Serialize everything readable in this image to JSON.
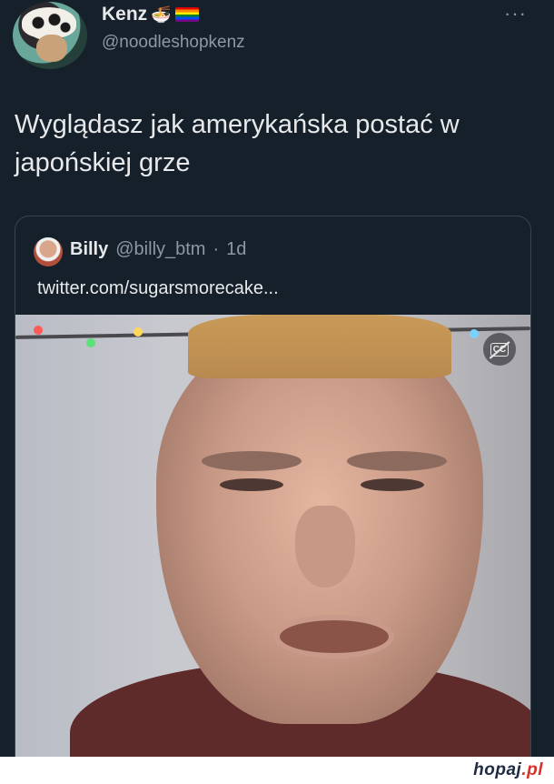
{
  "tweet": {
    "display_name": "Kenz",
    "name_emoji": "🍜",
    "handle": "@noodleshopkenz",
    "more": "···",
    "text": "Wyglądasz jak amerykańska postać w japońskiej grze"
  },
  "quote": {
    "name": "Billy",
    "handle": "@billy_btm",
    "separator": "·",
    "time": "1d",
    "link": "twitter.com/sugarsmorecake..."
  },
  "media": {
    "cc_label": "CC"
  },
  "watermark": {
    "site": "hopaj",
    "tld": ".pl"
  },
  "colors": {
    "background": "#15202b",
    "text": "#e7e9ea",
    "secondary_text": "#8b98a5",
    "border": "#38444d"
  },
  "icons": [
    "more-icon",
    "rainbow-flag-icon",
    "noodle-icon",
    "captions-off-icon"
  ]
}
